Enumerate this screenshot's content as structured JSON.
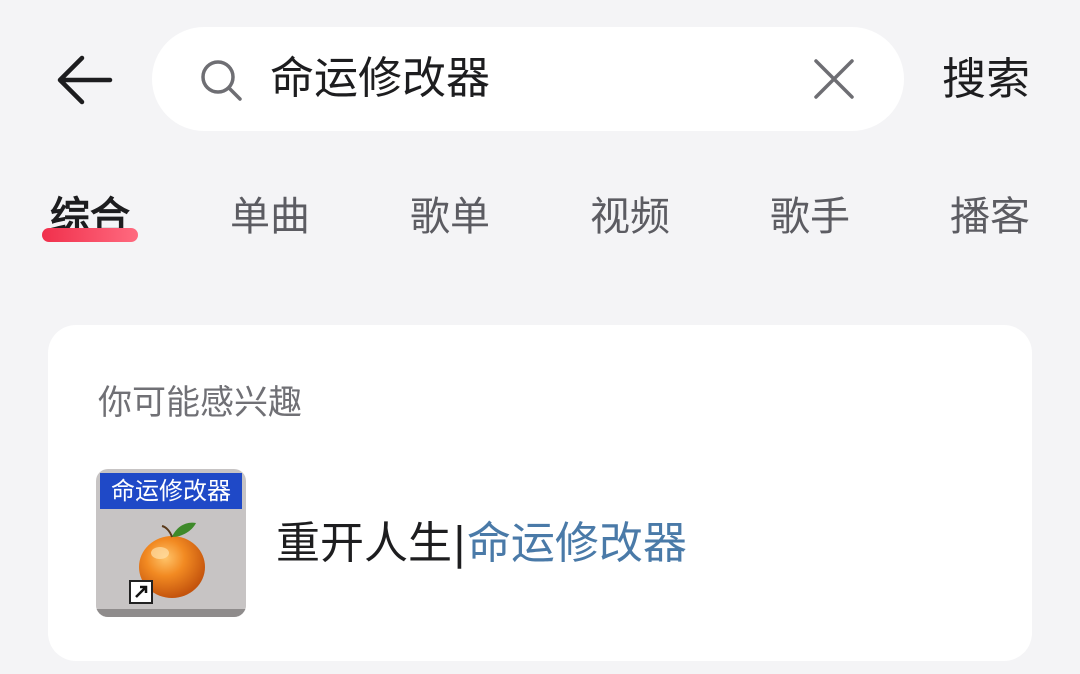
{
  "header": {
    "search_query": "命运修改器",
    "search_button_label": "搜索"
  },
  "tabs": [
    {
      "label": "综合",
      "active": true
    },
    {
      "label": "单曲",
      "active": false
    },
    {
      "label": "歌单",
      "active": false
    },
    {
      "label": "视频",
      "active": false
    },
    {
      "label": "歌手",
      "active": false
    },
    {
      "label": "播客",
      "active": false
    }
  ],
  "suggestion_card": {
    "title": "你可能感兴趣",
    "item": {
      "thumbnail_banner": "命运修改器",
      "title_prefix": "重开人生|",
      "title_highlight": "命运修改器"
    }
  },
  "colors": {
    "accent": "#f0304c",
    "highlight": "#4a7aa8",
    "thumbnail_banner": "#1f49c7"
  },
  "icons": {
    "back": "arrow-left-icon",
    "search": "search-icon",
    "clear": "close-icon",
    "thumbnail": "orange-shortcut-icon"
  }
}
